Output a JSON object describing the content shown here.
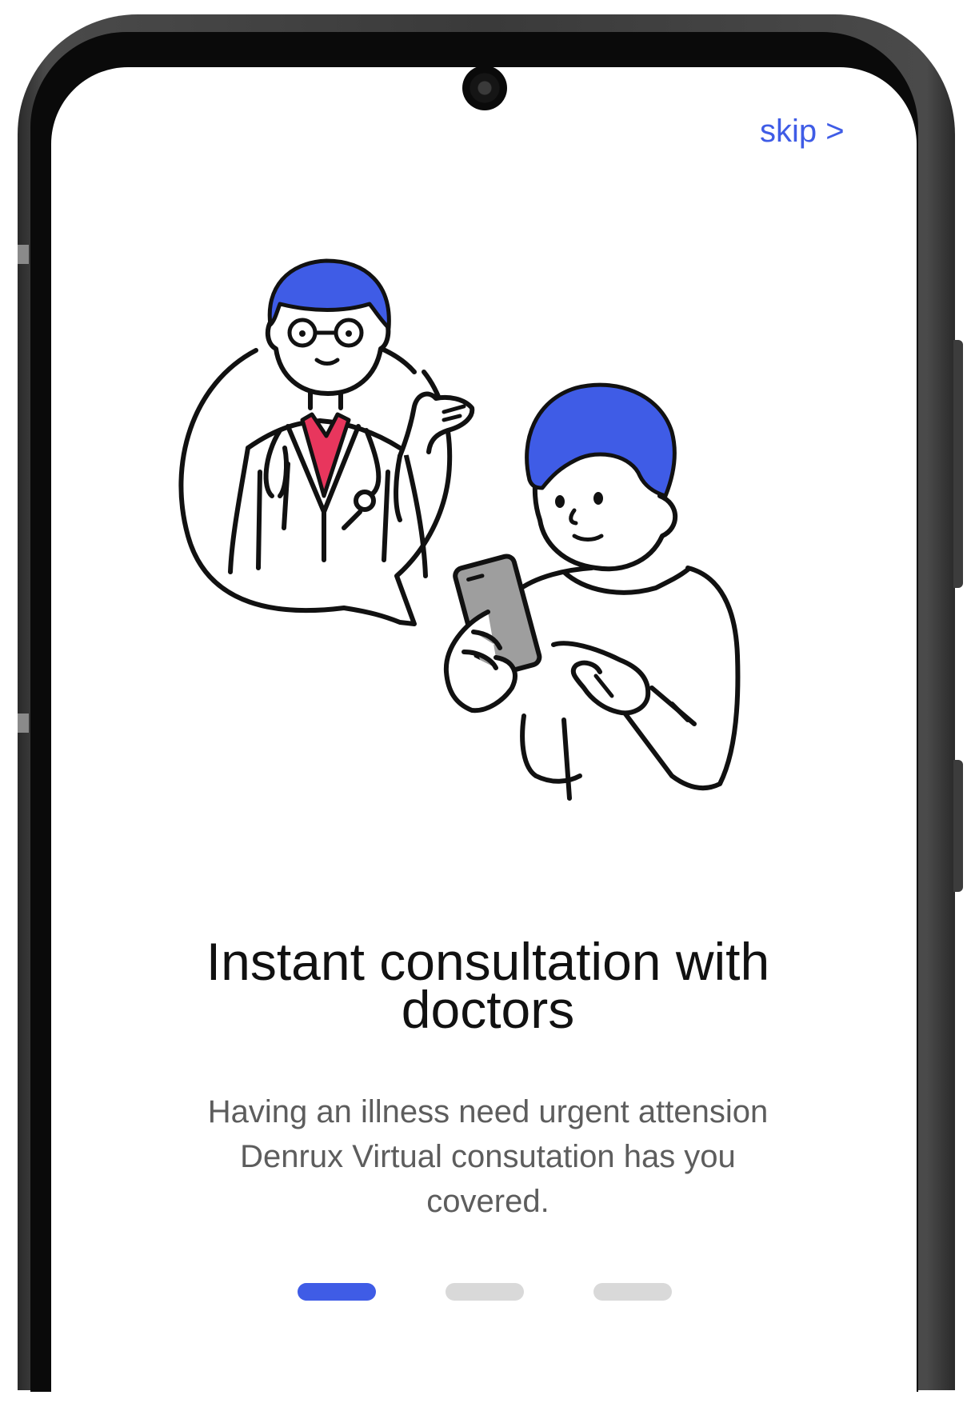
{
  "skip_label": "skip >",
  "onboarding": {
    "title": "Instant consultation with doctors",
    "description": "Having an illness need urgent attension Denrux Virtual consutation has you covered.",
    "pages": 3,
    "active_page": 1
  },
  "colors": {
    "accent": "#3f5ce6",
    "shirt_collar": "#e8365d",
    "inactive_dot": "#d9d9d9",
    "phone_screen": "#9e9e9e"
  },
  "icons": {
    "camera": "front-camera-icon"
  }
}
